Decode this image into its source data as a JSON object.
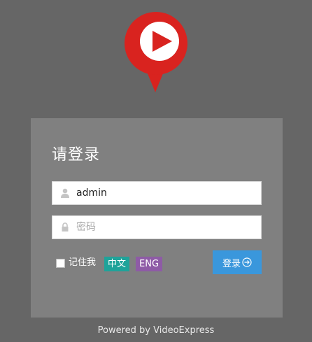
{
  "logo": {
    "icon": "play-pin-icon",
    "colors": {
      "pin": "#d9231f",
      "disc": "#ffffff",
      "play": "#d9231f"
    }
  },
  "login": {
    "title": "请登录",
    "username_value": "admin",
    "password_placeholder": "密码",
    "remember_label": "记住我",
    "remember_checked": false,
    "lang_zh": "中文",
    "lang_en": "ENG",
    "submit_label": "登录"
  },
  "footer": {
    "text": "Powered by VideoExpress"
  },
  "colors": {
    "background": "#666666",
    "panel": "#808080",
    "login_button": "#3a97dc",
    "lang_zh": "#1fa39a",
    "lang_en": "#8e5ba6"
  }
}
